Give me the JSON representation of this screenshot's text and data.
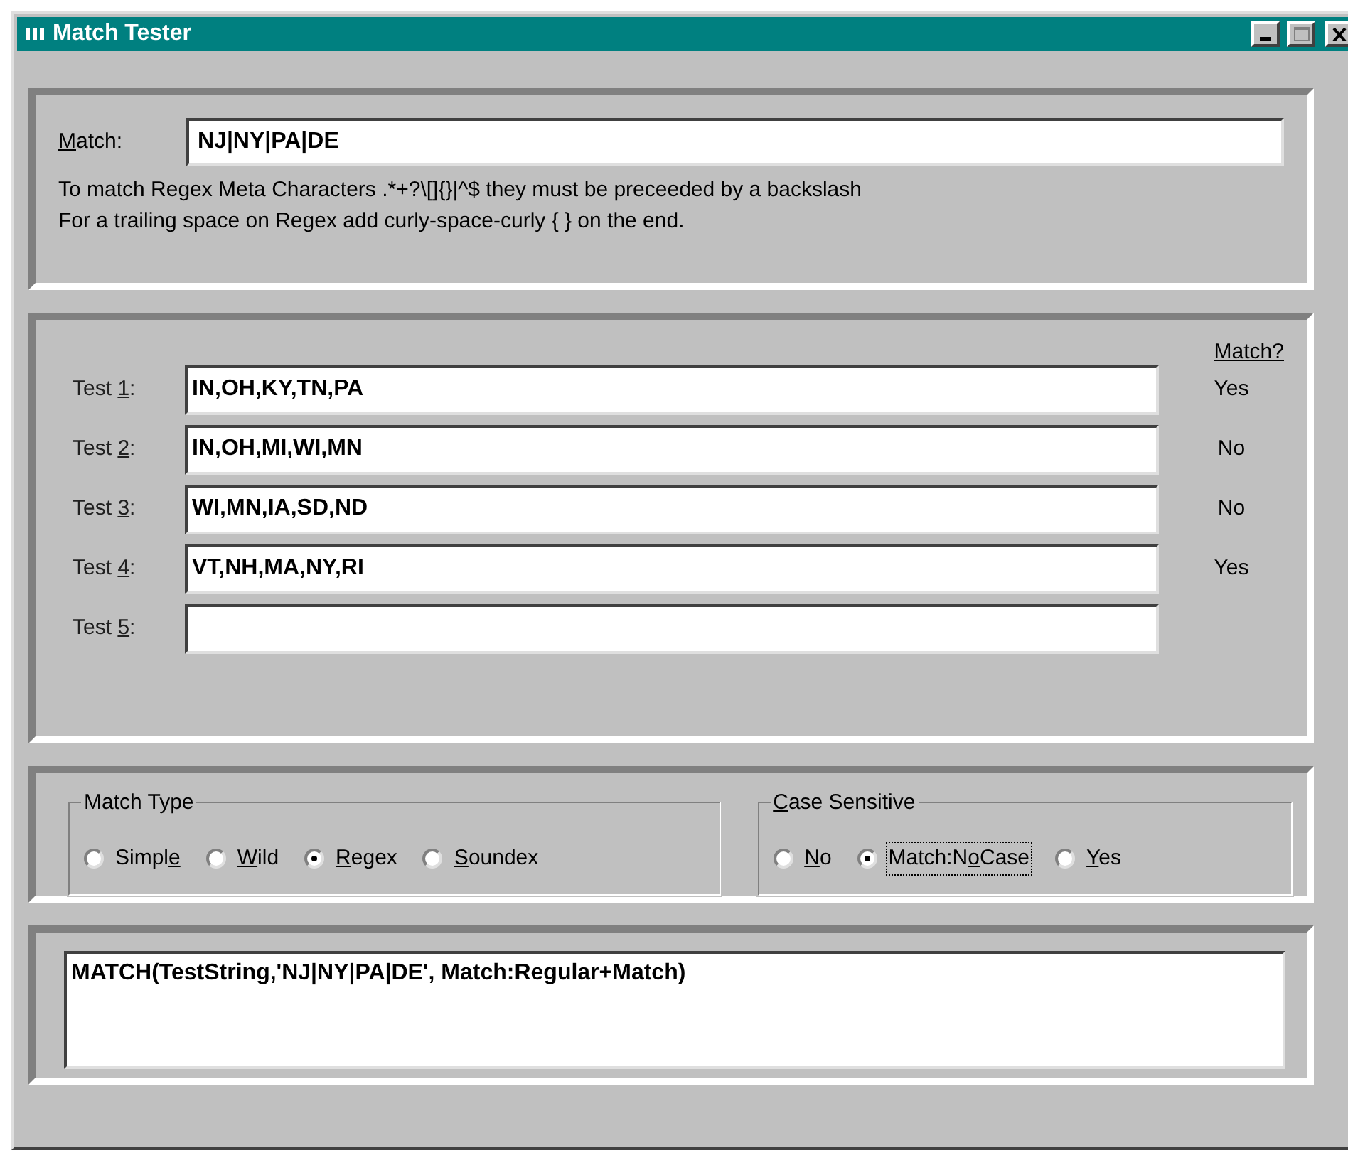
{
  "window": {
    "title": "Match Tester"
  },
  "match": {
    "label": {
      "key": "M",
      "after": "atch:"
    },
    "value": "NJ|NY|PA|DE"
  },
  "notes": [
    "To match Regex Meta Characters .*+?\\[]{}|^$ they must be preceeded by a backslash",
    "For a trailing space on Regex add curly-space-curly { } on the end."
  ],
  "tests": {
    "header": "Match?",
    "rows": [
      {
        "label": {
          "before": "Test ",
          "key": "1",
          "after": ":"
        },
        "value": "IN,OH,KY,TN,PA",
        "result": "Yes"
      },
      {
        "label": {
          "before": "Test ",
          "key": "2",
          "after": ":"
        },
        "value": "IN,OH,MI,WI,MN",
        "result": "No"
      },
      {
        "label": {
          "before": "Test ",
          "key": "3",
          "after": ":"
        },
        "value": "WI,MN,IA,SD,ND",
        "result": "No"
      },
      {
        "label": {
          "before": "Test ",
          "key": "4",
          "after": ":"
        },
        "value": "VT,NH,MA,NY,RI",
        "result": "Yes"
      },
      {
        "label": {
          "before": "Test ",
          "key": "5",
          "after": ":"
        }
      }
    ]
  },
  "match_type": {
    "title": {
      "before": "Match Type"
    },
    "options": [
      {
        "label": {
          "before": "Simpl",
          "key": "e"
        },
        "selected": false,
        "focused": false
      },
      {
        "label": {
          "key": "W",
          "after": "ild"
        },
        "selected": false,
        "focused": false
      },
      {
        "label": {
          "key": "R",
          "after": "egex"
        },
        "selected": true,
        "focused": false
      },
      {
        "label": {
          "key": "S",
          "after": "oundex"
        },
        "selected": false,
        "focused": false
      }
    ]
  },
  "case_sensitive": {
    "title": {
      "key": "C",
      "after": "ase Sensitive"
    },
    "options": [
      {
        "label": {
          "key": "N",
          "after": "o"
        },
        "selected": false,
        "focused": false
      },
      {
        "label": {
          "before": "Match:N",
          "key": "o",
          "after": "Case"
        },
        "selected": true,
        "focused": true
      },
      {
        "label": {
          "key": "Y",
          "after": "es"
        },
        "selected": false,
        "focused": false
      }
    ]
  },
  "output": {
    "value": "MATCH(TestString,'NJ|NY|PA|DE', Match:Regular+Match)"
  }
}
